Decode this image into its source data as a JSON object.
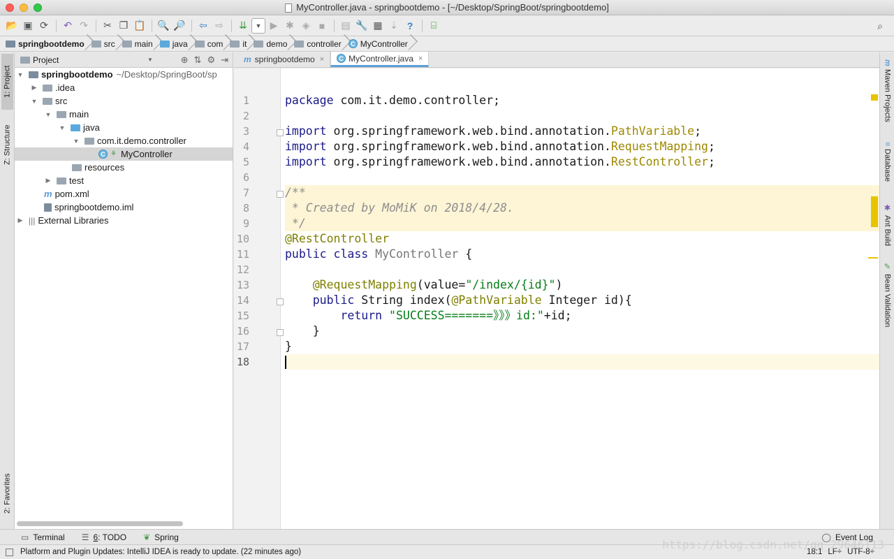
{
  "window": {
    "title": "MyController.java - springbootdemo - [~/Desktop/SpringBoot/springbootdemo]"
  },
  "toolbar": {
    "icons": [
      "open-folder",
      "save",
      "sync",
      "undo",
      "redo",
      "cut",
      "copy",
      "paste",
      "find",
      "replace",
      "back",
      "forward",
      "build",
      "run-config",
      "run",
      "debug",
      "coverage",
      "stop",
      "attach",
      "sdk",
      "structure",
      "vcs",
      "help",
      "terminal"
    ]
  },
  "breadcrumb": [
    "springbootdemo",
    "src",
    "main",
    "java",
    "com",
    "it",
    "demo",
    "controller",
    "MyController"
  ],
  "project_panel": {
    "title": "Project",
    "tree": [
      {
        "label": "springbootdemo",
        "suffix": "~/Desktop/SpringBoot/sp",
        "depth": 0
      },
      {
        "label": ".idea",
        "depth": 1
      },
      {
        "label": "src",
        "depth": 1
      },
      {
        "label": "main",
        "depth": 2
      },
      {
        "label": "java",
        "depth": 3
      },
      {
        "label": "com.it.demo.controller",
        "depth": 4
      },
      {
        "label": "MyController",
        "depth": 5
      },
      {
        "label": "resources",
        "depth": 3
      },
      {
        "label": "test",
        "depth": 2
      },
      {
        "label": "pom.xml",
        "depth": 1
      },
      {
        "label": "springbootdemo.iml",
        "depth": 1
      },
      {
        "label": "External Libraries",
        "depth": 0
      }
    ]
  },
  "left_tabs": {
    "project": "1: Project",
    "structure": "Z: Structure",
    "favorites": "2: Favorites"
  },
  "right_tabs": {
    "maven": "Maven Projects",
    "database": "Database",
    "ant": "Ant Build",
    "bean": "Bean Validation"
  },
  "editor_tabs": [
    {
      "label": "springbootdemo",
      "active": false
    },
    {
      "label": "MyController.java",
      "active": true
    }
  ],
  "code": {
    "line1": [
      "package",
      " com.it.demo.controller;"
    ],
    "line3": [
      "import",
      " org.springframework.web.bind.annotation.",
      "PathVariable",
      ";"
    ],
    "line4": [
      "import",
      " org.springframework.web.bind.annotation.",
      "RequestMapping",
      ";"
    ],
    "line5": [
      "import",
      " org.springframework.web.bind.annotation.",
      "RestController",
      ";"
    ],
    "line7": "/**",
    "line8": " * Created by MoMiK on 2018/4/28.",
    "line9": " */",
    "line10": "@RestController",
    "line11": [
      "public class",
      " MyController",
      " {"
    ],
    "line13": [
      "    ",
      "@RequestMapping",
      "(value=",
      "\"/index/{id}\"",
      ")"
    ],
    "line14": [
      "    ",
      "public",
      " String index(",
      "@PathVariable",
      " Integer id){"
    ],
    "line15": [
      "        ",
      "return",
      " ",
      "\"SUCCESS=======》》》id:\"",
      "+id;"
    ],
    "line16": "    }",
    "line17": "}",
    "line_numbers": [
      "1",
      "2",
      "3",
      "4",
      "5",
      "6",
      "7",
      "8",
      "9",
      "10",
      "11",
      "12",
      "13",
      "14",
      "15",
      "16",
      "17",
      "18"
    ]
  },
  "bottom_tabs": {
    "terminal": "Terminal",
    "todo_num": "6",
    "todo": ": TODO",
    "spring": "Spring",
    "event_log": "Event Log"
  },
  "status": {
    "message": "Platform and Plugin Updates: IntelliJ IDEA is ready to update. (22 minutes ago)",
    "position": "18:1",
    "line_sep": "LF÷",
    "encoding": "UTF-8÷"
  },
  "watermark": "https://blog.csdn.net/qq_29646113"
}
